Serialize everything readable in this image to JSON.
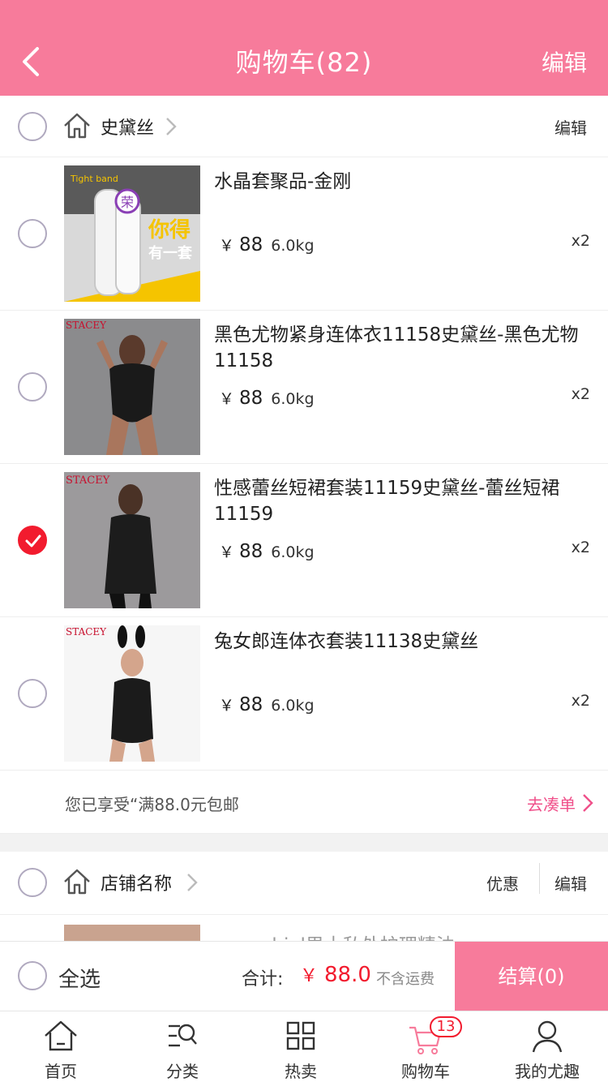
{
  "header": {
    "title": "购物车(82)",
    "edit": "编辑"
  },
  "store1": {
    "name": "史黛丝",
    "edit": "编辑",
    "items": [
      {
        "title": "水晶套聚品-金刚",
        "yen": "￥",
        "price": "88",
        "weight": "6.0kg",
        "qty": "x2",
        "checked": false,
        "thumb_text_brand": "Tight band",
        "thumb_text_1": "你得",
        "thumb_text_2": "有一套",
        "thumb_badge": "荣"
      },
      {
        "title": "黑色尤物紧身连体衣11158史黛丝-黑色尤物11158",
        "yen": "￥",
        "price": "88",
        "weight": "6.0kg",
        "qty": "x2",
        "checked": false,
        "thumb_brand": "STACEY"
      },
      {
        "title": "性感蕾丝短裙套装11159史黛丝-蕾丝短裙11159",
        "yen": "￥",
        "price": "88",
        "weight": "6.0kg",
        "qty": "x2",
        "checked": true,
        "thumb_brand": "STACEY"
      },
      {
        "title": "兔女郎连体衣套装11138史黛丝",
        "yen": "￥",
        "price": "88",
        "weight": "6.0kg",
        "qty": "x2",
        "checked": false,
        "thumb_brand": "STACEY"
      }
    ],
    "shipping_msg": "您已享受“满88.0元包邮",
    "shipping_cta": "去凑单"
  },
  "store2": {
    "name": "店铺名称",
    "promo": "优惠",
    "edit": "编辑",
    "partial_item_title": "aoonubial男士私处护理精油"
  },
  "checkout": {
    "select_all": "全选",
    "sum_label": "合计:",
    "yen": "￥",
    "sum_value": "88.0",
    "ship_note": "不含运费",
    "button": "结算(0)"
  },
  "tabs": [
    {
      "label": "首页",
      "icon": "home-icon"
    },
    {
      "label": "分类",
      "icon": "category-search-icon"
    },
    {
      "label": "热卖",
      "icon": "grid-icon"
    },
    {
      "label": "购物车",
      "icon": "cart-icon",
      "badge": "13"
    },
    {
      "label": "我的尤趣",
      "icon": "user-icon"
    }
  ],
  "colors": {
    "accent": "#f77b9b",
    "price_red": "#f21b2e",
    "link_pink": "#f0508a"
  }
}
